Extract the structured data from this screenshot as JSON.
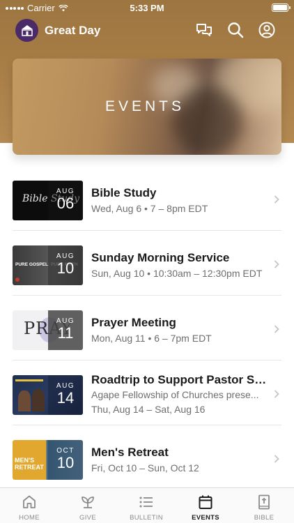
{
  "status_bar": {
    "carrier": "Carrier",
    "time": "5:33 PM"
  },
  "app": {
    "title": "Great Day",
    "icons": [
      "chat-icon",
      "search-icon",
      "profile-icon"
    ]
  },
  "hero": {
    "title": "EVENTS"
  },
  "events": [
    {
      "title": "Bible Study",
      "subtitle": "Wed, Aug 6 • 7 – 8pm EDT",
      "month": "AUG",
      "day": "06",
      "thumb_text": "Bible Study"
    },
    {
      "title": "Sunday Morning Service",
      "subtitle": "Sun, Aug 10 • 10:30am – 12:30pm EDT",
      "month": "AUG",
      "day": "10",
      "thumb_text": "PURE GOSPEL: PURE FAITH"
    },
    {
      "title": "Prayer Meeting",
      "subtitle": "Mon, Aug 11 • 6 – 7pm EDT",
      "month": "AUG",
      "day": "11",
      "thumb_text": "PRAY"
    },
    {
      "title": "Roadtrip to Support Pastor Sm...",
      "subtitle": "Agape Fellowship of Churches prese...",
      "subtitle2": "Thu, Aug 14 – Sat, Aug 16",
      "month": "AUG",
      "day": "14",
      "thumb_text": ""
    },
    {
      "title": "Men's Retreat",
      "subtitle": "Fri, Oct 10 – Sun, Oct 12",
      "month": "OCT",
      "day": "10",
      "thumb_text": "MEN'S RETREAT"
    }
  ],
  "tabs": [
    {
      "label": "HOME",
      "icon": "home-icon",
      "active": false
    },
    {
      "label": "GIVE",
      "icon": "give-icon",
      "active": false
    },
    {
      "label": "BULLETIN",
      "icon": "bulletin-icon",
      "active": false
    },
    {
      "label": "EVENTS",
      "icon": "calendar-icon",
      "active": true
    },
    {
      "label": "BIBLE",
      "icon": "bible-icon",
      "active": false
    }
  ],
  "colors": {
    "header": "#a87d46",
    "logo_bg": "#4b2a68",
    "active_tab": "#1a1a1a",
    "inactive_tab": "#8a8a8a"
  }
}
